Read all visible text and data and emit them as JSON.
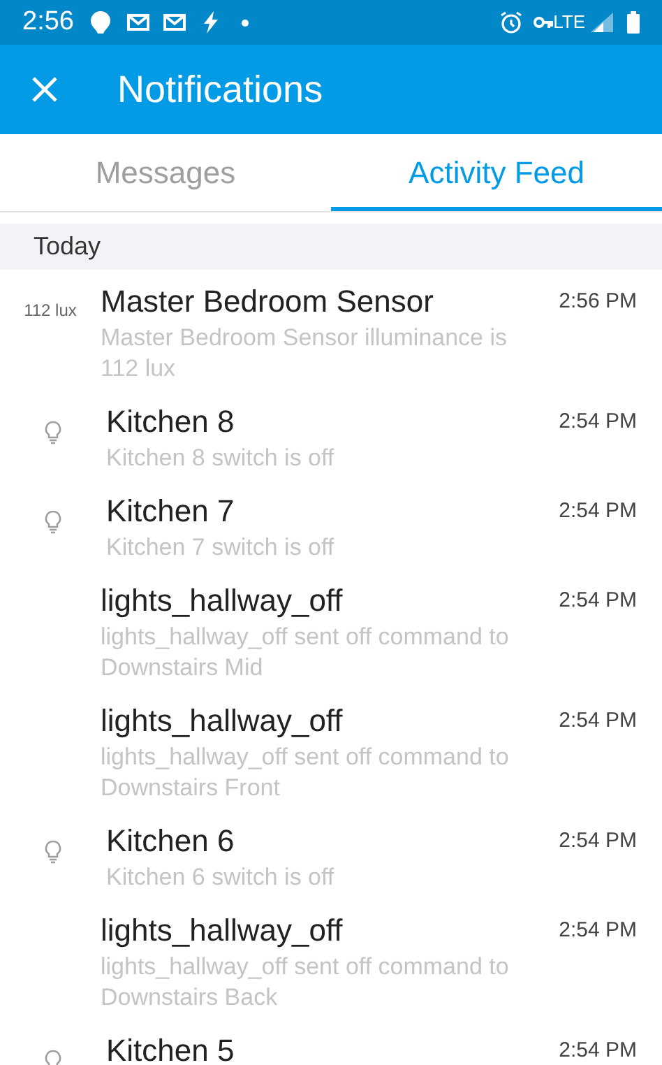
{
  "status_bar": {
    "time": "2:56",
    "network": "LTE"
  },
  "app_bar": {
    "title": "Notifications"
  },
  "tabs": [
    {
      "label": "Messages",
      "selected": false
    },
    {
      "label": "Activity Feed",
      "selected": true
    }
  ],
  "section": "Today",
  "events": [
    {
      "kind": "reading",
      "reading": "112 lux",
      "title": "Master Bedroom Sensor",
      "time": "2:56 PM",
      "description": "Master Bedroom Sensor illuminance is 112 lux"
    },
    {
      "kind": "light",
      "title": "Kitchen 8",
      "time": "2:54 PM",
      "description": "Kitchen 8 switch is off"
    },
    {
      "kind": "light",
      "title": "Kitchen 7",
      "time": "2:54 PM",
      "description": "Kitchen 7 switch is off"
    },
    {
      "kind": "command",
      "title": "lights_hallway_off",
      "time": "2:54 PM",
      "description": "lights_hallway_off sent off command to Downstairs Mid"
    },
    {
      "kind": "command",
      "title": "lights_hallway_off",
      "time": "2:54 PM",
      "description": "lights_hallway_off sent off command to Downstairs Front"
    },
    {
      "kind": "light",
      "title": "Kitchen 6",
      "time": "2:54 PM",
      "description": "Kitchen 6 switch is off"
    },
    {
      "kind": "command",
      "title": "lights_hallway_off",
      "time": "2:54 PM",
      "description": "lights_hallway_off sent off command to Downstairs Back"
    },
    {
      "kind": "light",
      "title": "Kitchen 5",
      "time": "2:54 PM"
    }
  ]
}
